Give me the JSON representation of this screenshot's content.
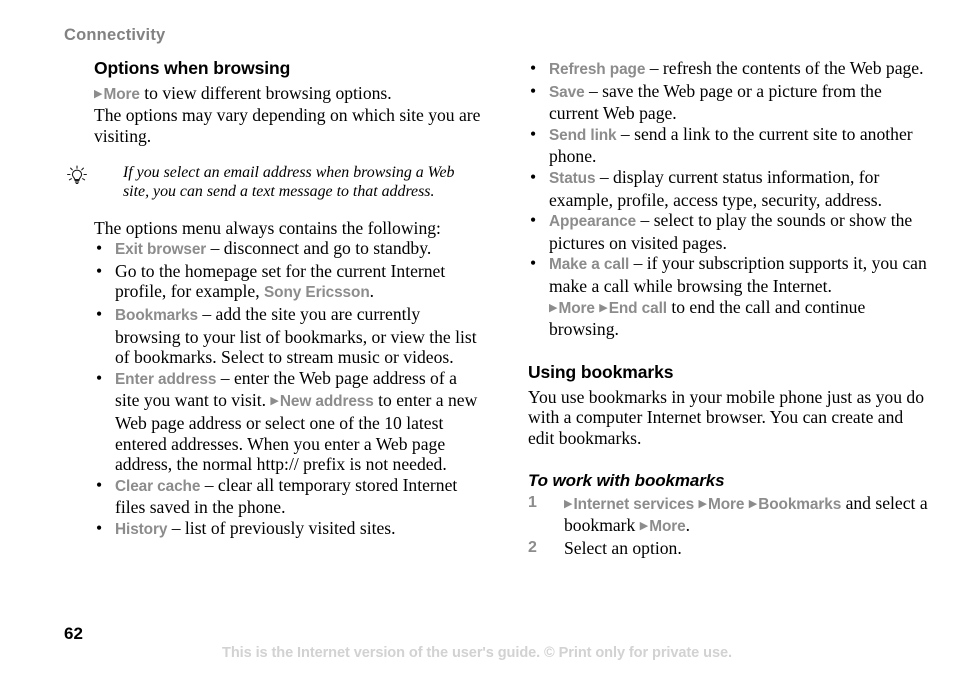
{
  "page": {
    "running_header": "Connectivity",
    "number": "62",
    "footer_note": "This is the Internet version of the user's guide. © Print only for private use."
  },
  "colors": {
    "ui_label_gray": "#8c8c8c",
    "running_header_gray": "#828282",
    "footer_gray": "#d2d2d2",
    "body_black": "#000000"
  },
  "icons": {
    "tip": "lightbulb-icon",
    "arrow": "▶",
    "bullet": "•"
  },
  "left_column": {
    "heading": "Options when browsing",
    "intro_line1_ui": "More",
    "intro_line1_rest": " to view different browsing options.",
    "intro_line2": "The options may vary depending on which site you are visiting.",
    "tip": "If you select an email address when browsing a Web site, you can send a text message to that address.",
    "list_intro": "The options menu always contains the following:",
    "bullets": [
      {
        "label": "Exit browser",
        "dash": " – ",
        "text": "disconnect and go to standby."
      },
      {
        "label": "",
        "dash": "",
        "text": "Go to the homepage set for the current Internet profile, for example, ",
        "trailing_label": "Sony Ericsson",
        "trailing_text": "."
      },
      {
        "label": "Bookmarks",
        "dash": " – ",
        "text": "add the site you are currently browsing to your list of bookmarks, or view the list of bookmarks. Select to stream music or videos."
      },
      {
        "label": "Enter address",
        "dash": " – ",
        "text": "enter the Web page address of a site you want to visit. ",
        "mid_label": "New address",
        "text2": " to enter a new Web page address or select one of the 10 latest entered addresses. When you enter a Web page address, the normal http:// prefix is not needed."
      },
      {
        "label": "Clear cache",
        "dash": " – ",
        "text": "clear all temporary stored Internet files saved in the phone."
      },
      {
        "label": "History",
        "dash": " – ",
        "text": "list of previously visited sites."
      }
    ]
  },
  "right_column": {
    "bullets": [
      {
        "label": "Refresh page",
        "dash": " – ",
        "text": "refresh the contents of the Web page."
      },
      {
        "label": "Save",
        "dash": " – ",
        "text": "save the Web page or a picture from the current Web page."
      },
      {
        "label": "Send link",
        "dash": " – ",
        "text": "send a link to the current site to another phone."
      },
      {
        "label": "Status",
        "dash": " – ",
        "text": "display current status information, for example, profile, access type, security, address."
      },
      {
        "label": "Appearance",
        "dash": " – ",
        "text": "select to play the sounds or show the pictures on visited pages."
      },
      {
        "label": "Make a call",
        "dash": " – ",
        "text": "if your subscription supports it, you can make a call while browsing the Internet.",
        "sub_label1": "More",
        "sub_label2": "End call",
        "sub_text": " to end the call and continue browsing."
      }
    ],
    "section2": {
      "heading": "Using bookmarks",
      "body": "You use bookmarks in your mobile phone just as you do with a computer Internet browser. You can create and edit bookmarks.",
      "task_heading": "To work with bookmarks",
      "steps": [
        {
          "num": "1",
          "label1": "Internet services",
          "label2": "More",
          "label3": "Bookmarks",
          "mid_text": " and select a bookmark ",
          "label4": "More",
          "end_text": "."
        },
        {
          "num": "2",
          "text": "Select an option."
        }
      ]
    }
  }
}
